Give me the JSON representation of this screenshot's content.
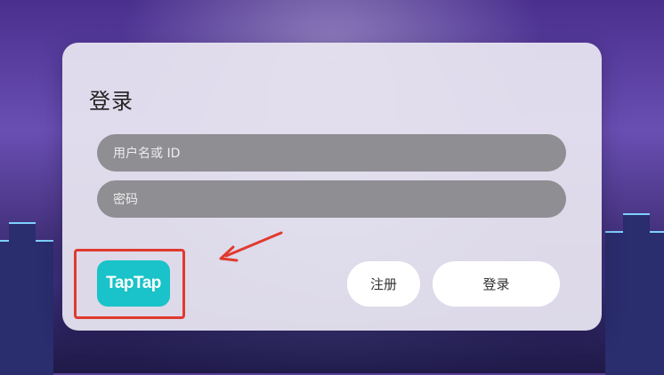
{
  "login": {
    "title": "登录",
    "username_placeholder": "用户名或 ID",
    "password_placeholder": "密码",
    "taptap_label": "TapTap",
    "register_label": "注册",
    "login_label": "登录"
  },
  "colors": {
    "taptap_brand": "#19c3c9",
    "annotation": "#e03a2e",
    "field_bg": "#8e8e93"
  }
}
